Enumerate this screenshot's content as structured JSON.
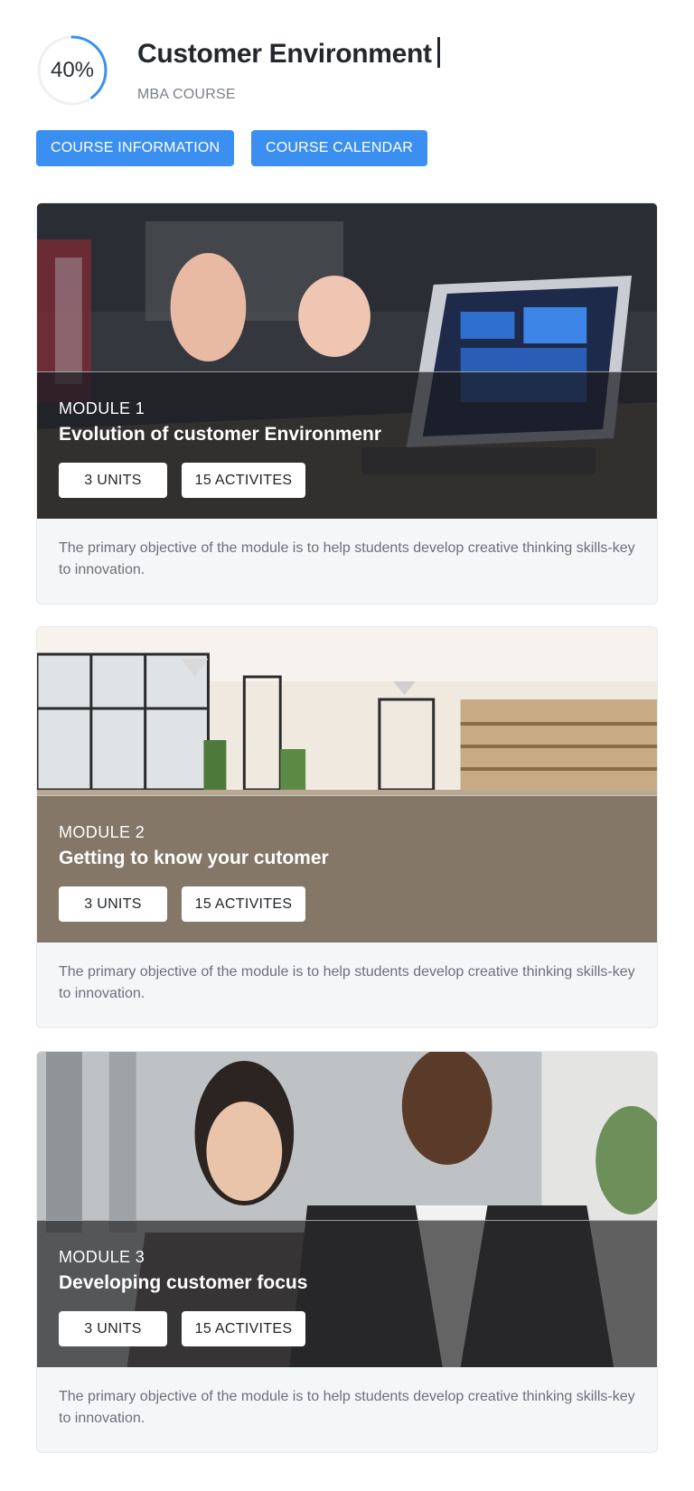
{
  "header": {
    "progress_label": "40%",
    "progress_fraction": 0.4,
    "progress_color": "#3a8ff0",
    "title": "Customer Environment",
    "subtitle": "MBA COURSE"
  },
  "actions": {
    "course_information": "COURSE INFORMATION",
    "course_calendar": "COURSE CALENDAR",
    "accent_color": "#3a8ff0"
  },
  "modules": [
    {
      "number": "MODULE 1",
      "title": "Evolution of customer Environmenr",
      "units": "3 UNITS",
      "activities": "15 ACTIVITES",
      "description": "The primary objective of the module is to help students develop creative thinking skills-key to innovation.",
      "image": "meeting-photo"
    },
    {
      "number": "MODULE 2",
      "title": "Getting to know your cutomer",
      "units": "3 UNITS",
      "activities": "15 ACTIVITES",
      "description": "The primary objective of the module is to help students develop creative thinking skills-key to innovation.",
      "image": "office-photo"
    },
    {
      "number": "MODULE 3",
      "title": "Developing customer focus",
      "units": "3 UNITS",
      "activities": "15 ACTIVITES",
      "description": "The primary objective of the module is to help students develop creative thinking skills-key to innovation.",
      "image": "people-photo"
    }
  ]
}
